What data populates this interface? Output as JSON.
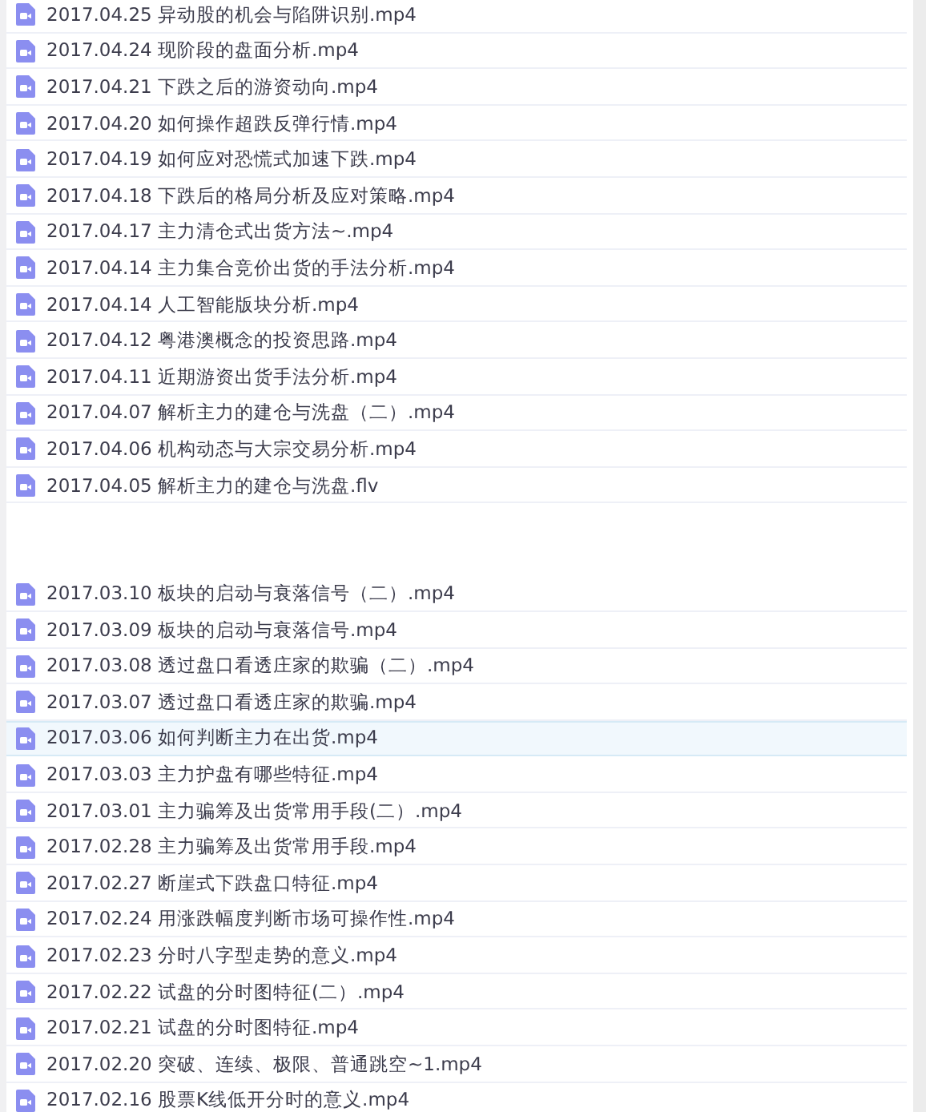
{
  "file_groups": [
    {
      "files": [
        {
          "label": "2017.04.25 异动股的机会与陷阱识别.mp4",
          "selected": false
        },
        {
          "label": "2017.04.24 现阶段的盘面分析.mp4",
          "selected": false
        },
        {
          "label": "2017.04.21 下跌之后的游资动向.mp4",
          "selected": false
        },
        {
          "label": "2017.04.20 如何操作超跌反弹行情.mp4",
          "selected": false
        },
        {
          "label": "2017.04.19 如何应对恐慌式加速下跌.mp4",
          "selected": false
        },
        {
          "label": "2017.04.18 下跌后的格局分析及应对策略.mp4",
          "selected": false
        },
        {
          "label": "2017.04.17 主力清仓式出货方法~.mp4",
          "selected": false
        },
        {
          "label": "2017.04.14 主力集合竞价出货的手法分析.mp4",
          "selected": false
        },
        {
          "label": "2017.04.14 人工智能版块分析.mp4",
          "selected": false
        },
        {
          "label": "2017.04.12 粤港澳概念的投资思路.mp4",
          "selected": false
        },
        {
          "label": "2017.04.11 近期游资出货手法分析.mp4",
          "selected": false
        },
        {
          "label": "2017.04.07 解析主力的建仓与洗盘（二）.mp4",
          "selected": false
        },
        {
          "label": "2017.04.06 机构动态与大宗交易分析.mp4",
          "selected": false
        },
        {
          "label": "2017.04.05 解析主力的建仓与洗盘.flv",
          "selected": false
        }
      ]
    },
    {
      "files": [
        {
          "label": "2017.03.10 板块的启动与衰落信号（二）.mp4",
          "selected": false
        },
        {
          "label": "2017.03.09 板块的启动与衰落信号.mp4",
          "selected": false
        },
        {
          "label": "2017.03.08 透过盘口看透庄家的欺骗（二）.mp4",
          "selected": false
        },
        {
          "label": "2017.03.07 透过盘口看透庄家的欺骗.mp4",
          "selected": false
        },
        {
          "label": "2017.03.06 如何判断主力在出货.mp4",
          "selected": true
        },
        {
          "label": "2017.03.03 主力护盘有哪些特征.mp4",
          "selected": false
        },
        {
          "label": "2017.03.01 主力骗筹及出货常用手段(二）.mp4",
          "selected": false
        },
        {
          "label": "2017.02.28 主力骗筹及出货常用手段.mp4",
          "selected": false
        },
        {
          "label": "2017.02.27 断崖式下跌盘口特征.mp4",
          "selected": false
        },
        {
          "label": "2017.02.24 用涨跌幅度判断市场可操作性.mp4",
          "selected": false
        },
        {
          "label": "2017.02.23 分时八字型走势的意义.mp4",
          "selected": false
        },
        {
          "label": "2017.02.22 试盘的分时图特征(二）.mp4",
          "selected": false
        },
        {
          "label": "2017.02.21 试盘的分时图特征.mp4",
          "selected": false
        },
        {
          "label": "2017.02.20 突破、连续、极限、普通跳空~1.mp4",
          "selected": false
        },
        {
          "label": "2017.02.16 股票K线低开分时的意义.mp4",
          "selected": false
        }
      ]
    }
  ]
}
